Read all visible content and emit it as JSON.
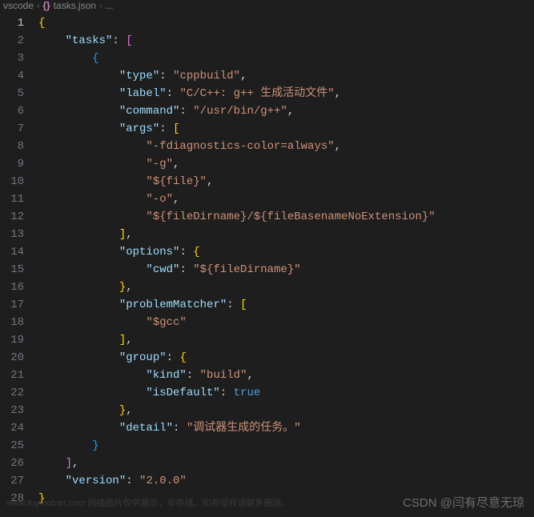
{
  "breadcrumb": {
    "folder": "vscode",
    "file": "tasks.json",
    "trail": "..."
  },
  "lines": [
    {
      "n": 1,
      "indent": 0,
      "tokens": [
        [
          "brace",
          "{"
        ]
      ]
    },
    {
      "n": 2,
      "indent": 1,
      "tokens": [
        [
          "key",
          "\"tasks\""
        ],
        [
          "punct",
          ": "
        ],
        [
          "bracket",
          "["
        ]
      ]
    },
    {
      "n": 3,
      "indent": 2,
      "tokens": [
        [
          "bracket2",
          "{"
        ]
      ]
    },
    {
      "n": 4,
      "indent": 3,
      "tokens": [
        [
          "key",
          "\"type\""
        ],
        [
          "punct",
          ": "
        ],
        [
          "string",
          "\"cppbuild\""
        ],
        [
          "punct",
          ","
        ]
      ]
    },
    {
      "n": 5,
      "indent": 3,
      "tokens": [
        [
          "key",
          "\"label\""
        ],
        [
          "punct",
          ": "
        ],
        [
          "string",
          "\"C/C++: g++ 生成活动文件\""
        ],
        [
          "punct",
          ","
        ]
      ]
    },
    {
      "n": 6,
      "indent": 3,
      "tokens": [
        [
          "key",
          "\"command\""
        ],
        [
          "punct",
          ": "
        ],
        [
          "string",
          "\"/usr/bin/g++\""
        ],
        [
          "punct",
          ","
        ]
      ]
    },
    {
      "n": 7,
      "indent": 3,
      "tokens": [
        [
          "key",
          "\"args\""
        ],
        [
          "punct",
          ": "
        ],
        [
          "brace",
          "["
        ]
      ]
    },
    {
      "n": 8,
      "indent": 4,
      "tokens": [
        [
          "string",
          "\"-fdiagnostics-color=always\""
        ],
        [
          "punct",
          ","
        ]
      ]
    },
    {
      "n": 9,
      "indent": 4,
      "tokens": [
        [
          "string",
          "\"-g\""
        ],
        [
          "punct",
          ","
        ]
      ]
    },
    {
      "n": 10,
      "indent": 4,
      "tokens": [
        [
          "string",
          "\"${file}\""
        ],
        [
          "punct",
          ","
        ]
      ]
    },
    {
      "n": 11,
      "indent": 4,
      "tokens": [
        [
          "string",
          "\"-o\""
        ],
        [
          "punct",
          ","
        ]
      ]
    },
    {
      "n": 12,
      "indent": 4,
      "tokens": [
        [
          "string",
          "\"${fileDirname}/${fileBasenameNoExtension}\""
        ]
      ]
    },
    {
      "n": 13,
      "indent": 3,
      "tokens": [
        [
          "brace",
          "]"
        ],
        [
          "punct",
          ","
        ]
      ]
    },
    {
      "n": 14,
      "indent": 3,
      "tokens": [
        [
          "key",
          "\"options\""
        ],
        [
          "punct",
          ": "
        ],
        [
          "brace",
          "{"
        ]
      ]
    },
    {
      "n": 15,
      "indent": 4,
      "tokens": [
        [
          "key",
          "\"cwd\""
        ],
        [
          "punct",
          ": "
        ],
        [
          "string",
          "\"${fileDirname}\""
        ]
      ]
    },
    {
      "n": 16,
      "indent": 3,
      "tokens": [
        [
          "brace",
          "}"
        ],
        [
          "punct",
          ","
        ]
      ]
    },
    {
      "n": 17,
      "indent": 3,
      "tokens": [
        [
          "key",
          "\"problemMatcher\""
        ],
        [
          "punct",
          ": "
        ],
        [
          "brace",
          "["
        ]
      ]
    },
    {
      "n": 18,
      "indent": 4,
      "tokens": [
        [
          "string",
          "\"$gcc\""
        ]
      ]
    },
    {
      "n": 19,
      "indent": 3,
      "tokens": [
        [
          "brace",
          "]"
        ],
        [
          "punct",
          ","
        ]
      ]
    },
    {
      "n": 20,
      "indent": 3,
      "tokens": [
        [
          "key",
          "\"group\""
        ],
        [
          "punct",
          ": "
        ],
        [
          "brace",
          "{"
        ]
      ]
    },
    {
      "n": 21,
      "indent": 4,
      "tokens": [
        [
          "key",
          "\"kind\""
        ],
        [
          "punct",
          ": "
        ],
        [
          "string",
          "\"build\""
        ],
        [
          "punct",
          ","
        ]
      ]
    },
    {
      "n": 22,
      "indent": 4,
      "tokens": [
        [
          "key",
          "\"isDefault\""
        ],
        [
          "punct",
          ": "
        ],
        [
          "keyword",
          "true"
        ]
      ]
    },
    {
      "n": 23,
      "indent": 3,
      "tokens": [
        [
          "brace",
          "}"
        ],
        [
          "punct",
          ","
        ]
      ]
    },
    {
      "n": 24,
      "indent": 3,
      "tokens": [
        [
          "key",
          "\"detail\""
        ],
        [
          "punct",
          ": "
        ],
        [
          "string",
          "\"调试器生成的任务。\""
        ]
      ]
    },
    {
      "n": 25,
      "indent": 2,
      "tokens": [
        [
          "bracket2",
          "}"
        ]
      ]
    },
    {
      "n": 26,
      "indent": 1,
      "tokens": [
        [
          "bracket",
          "]"
        ],
        [
          "punct",
          ","
        ]
      ]
    },
    {
      "n": 27,
      "indent": 1,
      "tokens": [
        [
          "key",
          "\"version\""
        ],
        [
          "punct",
          ": "
        ],
        [
          "string",
          "\"2.0.0\""
        ]
      ]
    },
    {
      "n": 28,
      "indent": 0,
      "tokens": [
        [
          "brace",
          "}"
        ]
      ]
    }
  ],
  "watermark": "CSDN @闫有尽意无琼",
  "faded_watermark": "www.tuymoban.com 网络图片仅供展示，非存储，如有侵权请联系删除。"
}
